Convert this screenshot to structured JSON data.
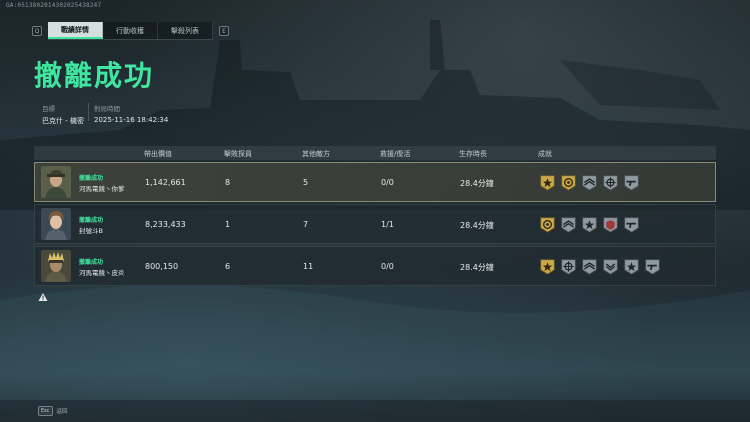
{
  "session_id": "GA:0513802014302025438247",
  "tabs": {
    "left_key": "Q",
    "right_key": "E",
    "items": [
      {
        "label": "戰績詳情",
        "active": true
      },
      {
        "label": "行動收穫",
        "active": false
      },
      {
        "label": "擊殺列表",
        "active": false
      }
    ]
  },
  "title": "撤離成功",
  "target": {
    "label": "目標",
    "value": "巴克什 - 機密"
  },
  "time": {
    "label": "對局時間",
    "value": "2025-11-16 18:42:34"
  },
  "columns": [
    "帶出價值",
    "擊敗探員",
    "其他敵方",
    "救援/復活",
    "生存時長",
    "成就"
  ],
  "players": [
    {
      "status": "撤離成功",
      "name": "河馬電競丶你爹",
      "value": "1,142,661",
      "operators": "8",
      "enemies": "5",
      "rescue": "0/0",
      "survival": "28.4分鐘",
      "highlight": true,
      "achievements": [
        "tier-gold-star-icon",
        "tier-gold-medal-icon",
        "tier-silver-wing-icon",
        "tier-silver-crosshair-icon",
        "tier-silver-gun-icon"
      ]
    },
    {
      "status": "撤離成功",
      "name": "封號斗B",
      "value": "8,233,433",
      "operators": "1",
      "enemies": "7",
      "rescue": "1/1",
      "survival": "28.4分鐘",
      "highlight": false,
      "achievements": [
        "tier-gold-medal-icon",
        "tier-silver-wing-icon",
        "tier-silver-star-icon",
        "tier-red-shield-icon",
        "tier-silver-gun-icon"
      ]
    },
    {
      "status": "撤離成功",
      "name": "河馬電競丶皮炎",
      "value": "800,150",
      "operators": "6",
      "enemies": "11",
      "rescue": "0/0",
      "survival": "28.4分鐘",
      "highlight": false,
      "achievements": [
        "tier-gold-star-icon",
        "tier-silver-crosshair-icon",
        "tier-silver-wing-icon",
        "tier-silver-wing-alt-icon",
        "tier-silver-star-icon",
        "tier-silver-gun-icon"
      ]
    }
  ],
  "footer": {
    "key": "Esc",
    "label": "返回"
  },
  "colors": {
    "accent": "#3fe6a0",
    "gold": "#c9a74a",
    "silver": "#8f9aa0",
    "highlight_border": "#8c8a74"
  }
}
